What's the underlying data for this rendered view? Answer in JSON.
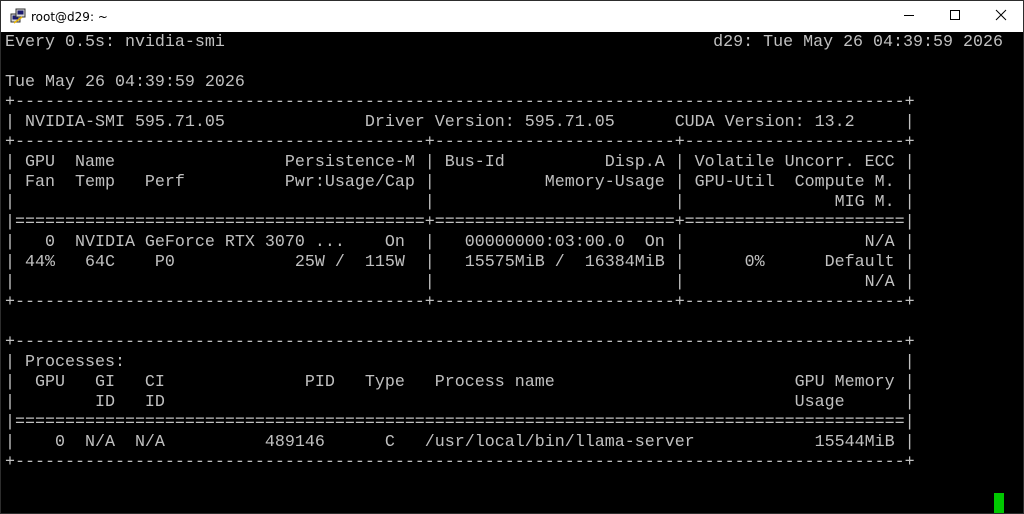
{
  "window": {
    "title": "root@d29: ~",
    "icon": "putty-icon",
    "controls": {
      "minimize": "minimize-icon",
      "maximize": "maximize-icon",
      "close": "close-icon"
    }
  },
  "terminal": {
    "header_left": "Every 0.5s: nvidia-smi",
    "header_right": "d29: Tue May 26 04:39:59 2026",
    "lines": [
      "",
      "Tue May 26 04:39:59 2026",
      "+-----------------------------------------------------------------------------------------+",
      "| NVIDIA-SMI 595.71.05              Driver Version: 595.71.05      CUDA Version: 13.2     |",
      "+-----------------------------------------+------------------------+----------------------+",
      "| GPU  Name                 Persistence-M | Bus-Id          Disp.A | Volatile Uncorr. ECC |",
      "| Fan  Temp   Perf          Pwr:Usage/Cap |           Memory-Usage | GPU-Util  Compute M. |",
      "|                                         |                        |               MIG M. |",
      "|=========================================+========================+======================|",
      "|   0  NVIDIA GeForce RTX 3070 ...    On  |   00000000:03:00.0  On |                  N/A |",
      "| 44%   64C    P0            25W /  115W  |   15575MiB /  16384MiB |      0%      Default |",
      "|                                         |                        |                  N/A |",
      "+-----------------------------------------+------------------------+----------------------+",
      "",
      "+-----------------------------------------------------------------------------------------+",
      "| Processes:                                                                              |",
      "|  GPU   GI   CI              PID   Type   Process name                        GPU Memory |",
      "|        ID   ID                                                               Usage      |",
      "|=========================================================================================|",
      "|    0  N/A  N/A          489146      C   /usr/local/bin/llama-server            15544MiB |",
      "+-----------------------------------------------------------------------------------------+"
    ]
  },
  "colors": {
    "terminal_bg": "#000000",
    "terminal_fg": "#c0c0c0",
    "cursor": "#00c800",
    "titlebar_bg": "#ffffff"
  }
}
